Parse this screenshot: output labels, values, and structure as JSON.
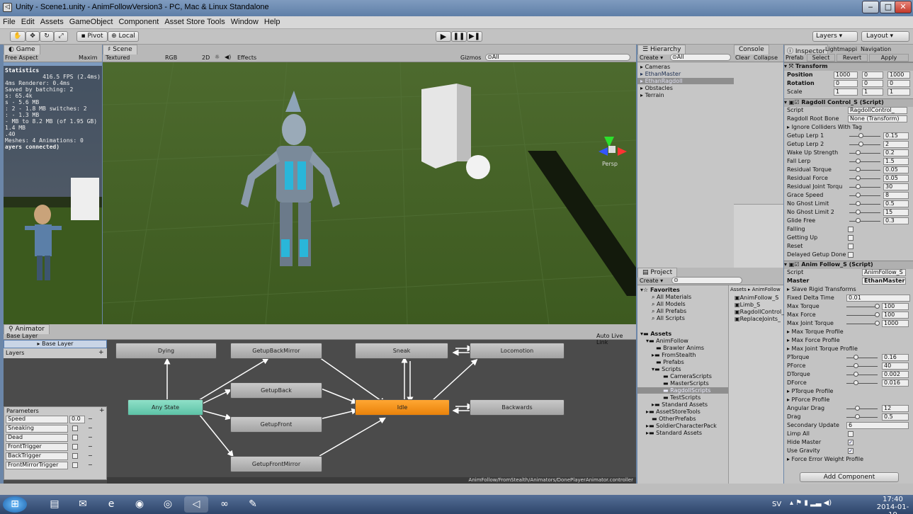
{
  "window": {
    "title": "Unity - Scene1.unity - AnimFollowVersion3 - PC, Mac & Linux Standalone"
  },
  "menu": [
    "File",
    "Edit",
    "Assets",
    "GameObject",
    "Component",
    "Asset Store Tools",
    "Window",
    "Help"
  ],
  "toolbar": {
    "pivot": "Pivot",
    "local": "Local",
    "layers": "Layers",
    "layout": "Layout"
  },
  "game": {
    "tab": "Game",
    "aspect": "Free Aspect",
    "maximize": "Maxim",
    "stats_title": "Statistics",
    "fps": "416.5 FPS (2.4ms)",
    "stats": [
      "4ms  Renderer: 0.4ms",
      "   Saved by batching: 2",
      "s: 65.4k",
      "s - 5.6 MB",
      ": 2 - 1.8 MB switches: 2",
      ": - 1.3 MB",
      "- MB to 8.2 MB (of 1.95 GB)",
      "1.4 MB",
      ".40",
      "Meshes: 4   Animations: 0",
      "ayers connected)"
    ]
  },
  "scene": {
    "tab": "Scene",
    "shading": "Textured",
    "rgb": "RGB",
    "mode2d": "2D",
    "effects": "Effects",
    "gizmos": "Gizmos",
    "search": "All",
    "persp": "Persp"
  },
  "hierarchy": {
    "tab": "Hierarchy",
    "create": "Create",
    "search": "All",
    "items": [
      "Cameras",
      "EthanMaster",
      "EthanRagdoll",
      "Obstacles",
      "Terrain"
    ]
  },
  "console": {
    "tab": "Console",
    "clear": "Clear",
    "collapse": "Collapse"
  },
  "project": {
    "tab": "Project",
    "create": "Create",
    "favorites": "Favorites",
    "fav_items": [
      "All Materials",
      "All Models",
      "All Prefabs",
      "All Scripts"
    ],
    "assets_title": "Assets",
    "tree": [
      "AnimFollow",
      "Brawler Anims",
      "FromStealth",
      "Prefabs",
      "Scripts",
      "CameraScripts",
      "MasterScripts",
      "RagdollScripts",
      "TestScripts",
      "Standard Assets",
      "AssetStoreTools",
      "OtherPrefabs",
      "SoldierCharacterPack",
      "Standard Assets"
    ],
    "breadcrumb": "Assets ▸ AnimFollow",
    "files": [
      "AnimFollow_S",
      "Limb_S",
      "RagdollControl_",
      "ReplaceJoints_"
    ]
  },
  "inspector": {
    "tabs": [
      "Inspector",
      "Lightmappi",
      "Navigation"
    ],
    "prefab": "Prefab",
    "select": "Select",
    "revert": "Revert",
    "apply": "Apply",
    "transform": {
      "title": "Transform",
      "position": "Position",
      "rotation": "Rotation",
      "scale": "Scale",
      "pos": [
        "1000",
        "0",
        "1000"
      ],
      "rot": [
        "0",
        "0",
        "0"
      ],
      "scl": [
        "1",
        "1",
        "1"
      ]
    },
    "ragdoll": {
      "title": "Ragdoll Control_S (Script)",
      "script_label": "Script",
      "script": "RagdollControl_",
      "root_label": "Ragdoll Root Bone",
      "root": "None (Transform)",
      "ignore": "Ignore Colliders With Tag",
      "params": [
        {
          "label": "Getup Lerp 1",
          "value": "0.15",
          "pos": 0.3
        },
        {
          "label": "Getup Lerp 2",
          "value": "2",
          "pos": 0.3
        },
        {
          "label": "Wake Up Strength",
          "value": "0.2",
          "pos": 0.2
        },
        {
          "label": "Fall Lerp",
          "value": "1.5",
          "pos": 0.2
        },
        {
          "label": "Residual Torque",
          "value": "0.05",
          "pos": 0.2
        },
        {
          "label": "Residual Force",
          "value": "0.05",
          "pos": 0.2
        },
        {
          "label": "Residual Joint Torqu",
          "value": "30",
          "pos": 0.2
        },
        {
          "label": "Grace Speed",
          "value": "8",
          "pos": 0.2
        },
        {
          "label": "No Ghost Limit",
          "value": "0.5",
          "pos": 0.2
        },
        {
          "label": "No Ghost Limit 2",
          "value": "15",
          "pos": 0.2
        },
        {
          "label": "Glide Free",
          "value": "0.3",
          "pos": 0.2
        }
      ],
      "checks": [
        {
          "label": "Falling",
          "checked": false
        },
        {
          "label": "Getting Up",
          "checked": false
        },
        {
          "label": "Reset",
          "checked": false
        },
        {
          "label": "Delayed Getup Done",
          "checked": false
        }
      ]
    },
    "animfollow": {
      "title": "Anim Follow_S (Script)",
      "script_label": "Script",
      "script": "AnimFollow_S",
      "master_label": "Master",
      "master": "EthanMaster",
      "slave": "Slave Rigid Transforms",
      "fdt_label": "Fixed Delta Time",
      "fdt": "0.01",
      "maxes": [
        {
          "label": "Max Torque",
          "value": "100"
        },
        {
          "label": "Max Force",
          "value": "100"
        },
        {
          "label": "Max Joint Torque",
          "value": "1000"
        }
      ],
      "profiles": [
        "Max Torque Profile",
        "Max Force Profile",
        "Max Joint Torque Profile"
      ],
      "pd": [
        {
          "label": "PTorque",
          "value": "0.16"
        },
        {
          "label": "PForce",
          "value": "40"
        },
        {
          "label": "DTorque",
          "value": "0.002"
        },
        {
          "label": "DForce",
          "value": "0.016"
        }
      ],
      "profiles2": [
        "PTorque Profile",
        "PForce Profile"
      ],
      "drags": [
        {
          "label": "Angular Drag",
          "value": "12"
        },
        {
          "label": "Drag",
          "value": "0.5"
        }
      ],
      "secondary_label": "Secondary Update",
      "secondary": "6",
      "checks": [
        {
          "label": "Limp All",
          "checked": false
        },
        {
          "label": "Hide Master",
          "checked": true
        },
        {
          "label": "Use Gravity",
          "checked": true
        }
      ],
      "force_profile": "Force Error Weight Profile"
    },
    "add_component": "Add Component"
  },
  "animator": {
    "tab": "Animator",
    "base_layer": "Base Layer",
    "layers": "Layers",
    "auto_live": "Auto Live Link",
    "path": "AnimFollow/FromStealth/Animators/DonePlayerAnimator.controller",
    "params_title": "Parameters",
    "params": [
      {
        "name": "Speed",
        "value": "0.0"
      },
      {
        "name": "Sneaking",
        "value": ""
      },
      {
        "name": "Dead",
        "value": ""
      },
      {
        "name": "FrontTrigger",
        "value": ""
      },
      {
        "name": "BackTrigger",
        "value": ""
      },
      {
        "name": "FrontMirrorTrigger",
        "value": ""
      }
    ],
    "states": {
      "dying": "Dying",
      "getup_back_mirror": "GetupBackMirror",
      "sneak": "Sneak",
      "locomotion": "Locomotion",
      "getup_back": "GetupBack",
      "any_state": "Any State",
      "idle": "Idle",
      "backwards": "Backwards",
      "getup_front": "GetupFront",
      "getup_front_mirror": "GetupFrontMirror"
    }
  },
  "taskbar": {
    "lang": "SV",
    "time": "17:40",
    "date": "2014-01-19"
  },
  "colors": {
    "idle": "#f08c0c",
    "any_state": "#6fd3b8",
    "selected": "#3d6fb0"
  }
}
